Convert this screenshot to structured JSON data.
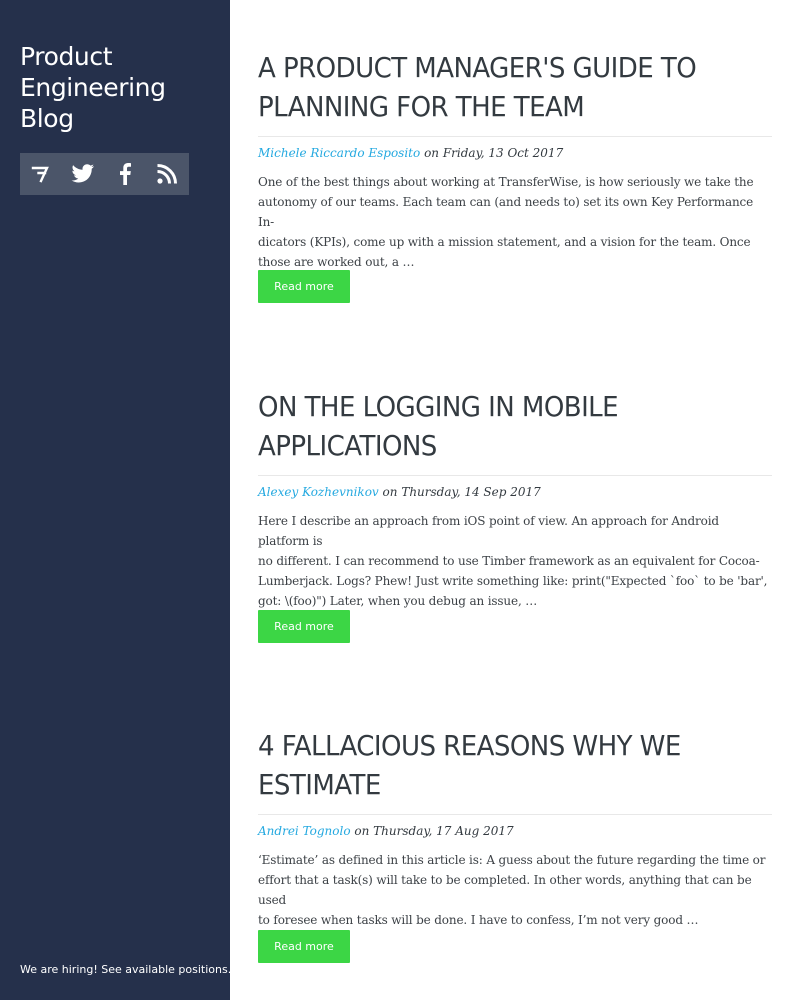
{
  "sidebar": {
    "title_lines": [
      "Product",
      "Engineering",
      "Blog"
    ],
    "social": [
      {
        "name": "transferwise-logo-icon"
      },
      {
        "name": "twitter-icon"
      },
      {
        "name": "facebook-icon"
      },
      {
        "name": "rss-icon"
      }
    ],
    "hiring_text": "We are hiring! See available positions.."
  },
  "posts": [
    {
      "title_lines": [
        "A PRODUCT MANAGER'S GUIDE TO",
        "PLANNING FOR THE TEAM"
      ],
      "author": "Michele Riccardo Esposito",
      "date_text": "on Friday, 13 Oct 2017",
      "excerpt_lines": [
        "One of the best things about working at TransferWise, is how seriously we take the",
        "autonomy of our teams. Each team can (and needs to) set its own Key Performance In-",
        "dicators (KPIs), come up with a mission statement, and a vision for the team. Once",
        "those are worked out, a …"
      ],
      "read_more": "Read more"
    },
    {
      "title_lines": [
        "ON THE LOGGING IN MOBILE",
        "APPLICATIONS"
      ],
      "author": "Alexey Kozhevnikov",
      "date_text": "on Thursday, 14 Sep 2017",
      "excerpt_lines": [
        "Here I describe an approach from iOS point of view. An approach for Android platform is",
        "no different. I can recommend to use Timber framework as an equivalent for Cocoa-",
        "Lumberjack. Logs? Phew! Just write something like: print(\"Expected `foo` to be 'bar',",
        "got: \\(foo)\") Later, when you debug an issue, …"
      ],
      "read_more": "Read more"
    },
    {
      "title_lines": [
        "4 FALLACIOUS REASONS WHY WE",
        "ESTIMATE"
      ],
      "author": "Andrei Tognolo",
      "date_text": "on Thursday, 17 Aug 2017",
      "excerpt_lines": [
        "‘Estimate’ as defined in this article is: A guess about the future regarding the time or",
        "effort that a task(s) will take to be completed. In other words, anything that can be used",
        "to foresee when tasks will be done. I have to confess, I’m not very good …"
      ],
      "read_more": "Read more"
    }
  ],
  "colors": {
    "sidebar_bg": "#25304b",
    "social_bar_bg": "#4b5569",
    "author_link": "#25a9e0",
    "read_more_bg": "#3cd645"
  }
}
